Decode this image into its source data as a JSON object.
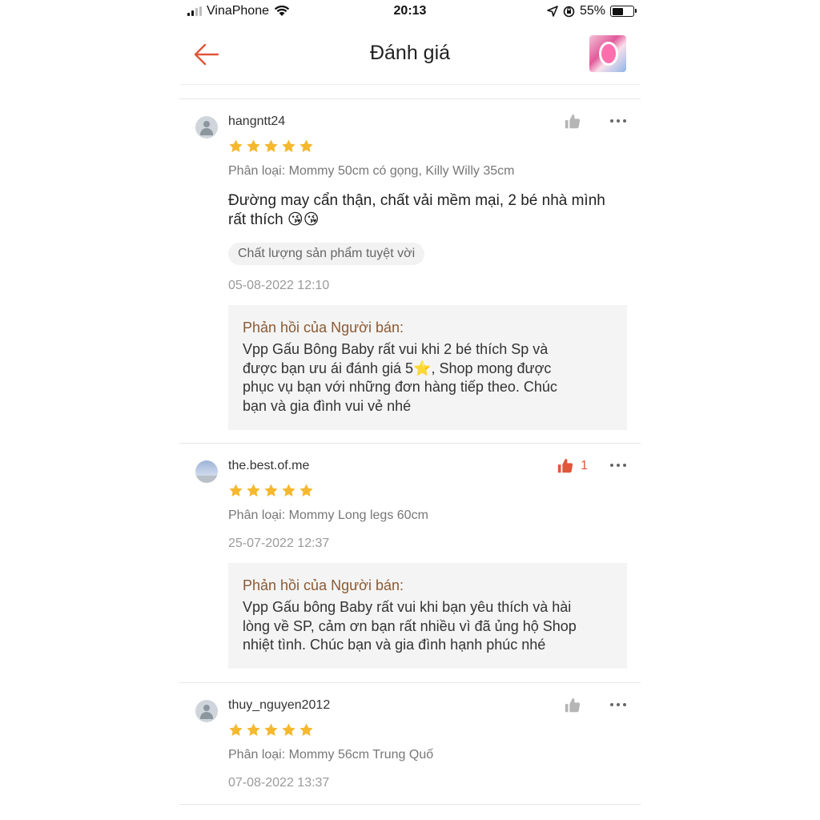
{
  "status_bar": {
    "carrier": "VinaPhone",
    "time": "20:13",
    "battery": "55%",
    "battery_level": 0.55
  },
  "header": {
    "title": "Đánh giá",
    "back_icon": "arrow-left-icon",
    "thumbnail": "product-thumbnail"
  },
  "colors": {
    "accent": "#e0563b",
    "star": "#f5b82e",
    "reply_title": "#8a5a34"
  },
  "reviews": [
    {
      "username": "hangntt24",
      "rating": 5,
      "variant": "Phân loại: Mommy 50cm có gọng, Killy Willy 35cm",
      "comment_line1": "Đường may cẩn thận, chất vải mềm mại, 2 bé nhà mình",
      "comment_line2": "rất thích 😘😘",
      "tag": "Chất lượng sản phẩm tuyệt vời",
      "date": "05-08-2022 12:10",
      "liked": false,
      "like_count": "",
      "reply_title": "Phản hồi của Người bán:",
      "reply_lines": [
        "Vpp Gấu Bông Baby rất vui khi 2 bé thích Sp và",
        "được bạn ưu ái đánh giá 5⭐, Shop mong được",
        "phục vụ bạn với những đơn hàng tiếp theo. Chúc",
        "bạn và gia đình vui vẻ nhé"
      ]
    },
    {
      "username": "the.best.of.me",
      "rating": 5,
      "variant": "Phân loại: Mommy Long legs 60cm",
      "date": "25-07-2022 12:37",
      "liked": true,
      "like_count": "1",
      "reply_title": "Phản hồi của Người bán:",
      "reply_lines": [
        "Vpp Gấu bông Baby rất vui khi bạn yêu thích và hài",
        "lòng về SP, cảm ơn bạn rất nhiều vì đã ủng hộ Shop",
        "nhiệt tình. Chúc bạn và gia đình hạnh phúc nhé"
      ]
    },
    {
      "username": "thuy_nguyen2012",
      "rating": 5,
      "variant": "Phân loại: Mommy 56cm Trung Quố",
      "date": "07-08-2022 13:37",
      "liked": false,
      "like_count": ""
    }
  ]
}
